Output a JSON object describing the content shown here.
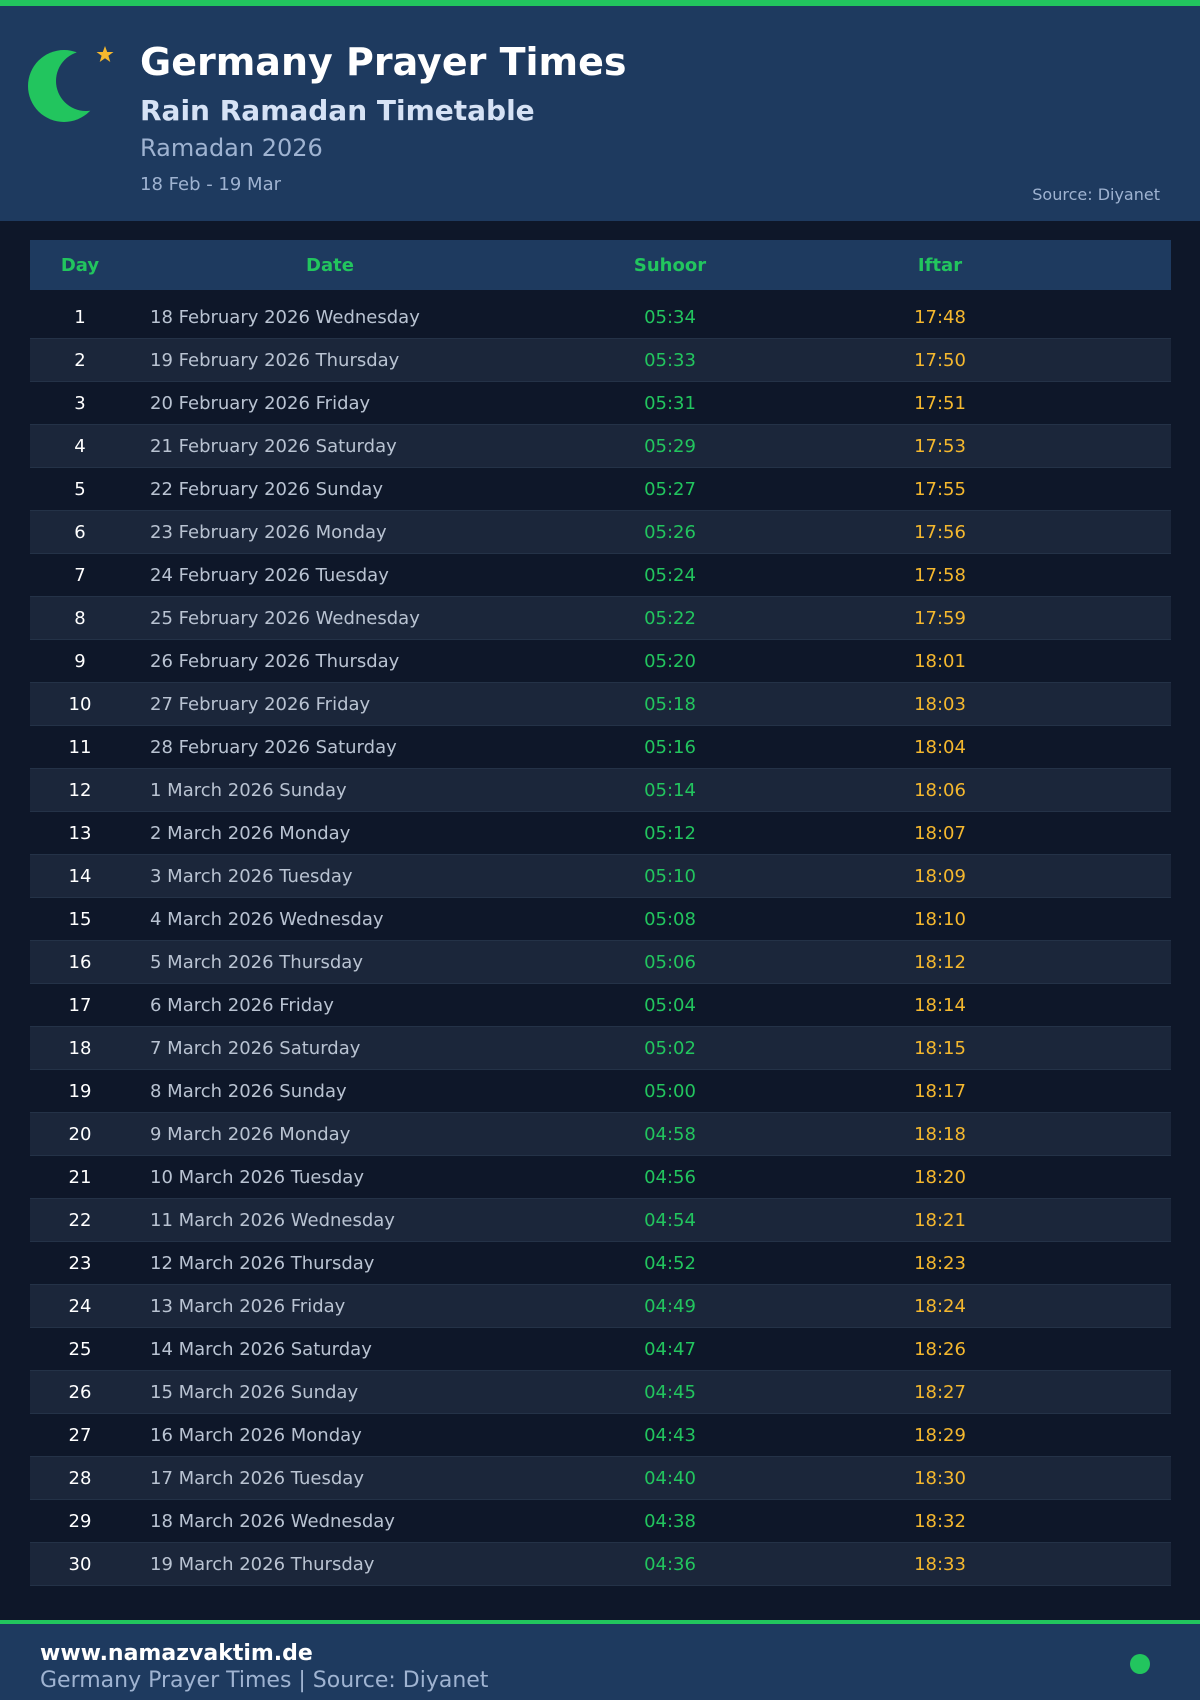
{
  "header": {
    "title": "Germany Prayer Times",
    "subtitle": "Rain Ramadan Timetable",
    "season": "Ramadan 2026",
    "range": "18 Feb - 19 Mar",
    "source": "Source: Diyanet",
    "logo_icon": "crescent-moon-star-icon"
  },
  "colors": {
    "accent_green": "#22c55e",
    "iftar_gold": "#f5b82e",
    "header_bg": "#1e3a5f",
    "page_bg": "#0e1729"
  },
  "table": {
    "columns": [
      "Day",
      "Date",
      "Suhoor",
      "Iftar"
    ],
    "rows": [
      {
        "day": "1",
        "date": "18 February 2026 Wednesday",
        "suhoor": "05:34",
        "iftar": "17:48"
      },
      {
        "day": "2",
        "date": "19 February 2026 Thursday",
        "suhoor": "05:33",
        "iftar": "17:50"
      },
      {
        "day": "3",
        "date": "20 February 2026 Friday",
        "suhoor": "05:31",
        "iftar": "17:51"
      },
      {
        "day": "4",
        "date": "21 February 2026 Saturday",
        "suhoor": "05:29",
        "iftar": "17:53"
      },
      {
        "day": "5",
        "date": "22 February 2026 Sunday",
        "suhoor": "05:27",
        "iftar": "17:55"
      },
      {
        "day": "6",
        "date": "23 February 2026 Monday",
        "suhoor": "05:26",
        "iftar": "17:56"
      },
      {
        "day": "7",
        "date": "24 February 2026 Tuesday",
        "suhoor": "05:24",
        "iftar": "17:58"
      },
      {
        "day": "8",
        "date": "25 February 2026 Wednesday",
        "suhoor": "05:22",
        "iftar": "17:59"
      },
      {
        "day": "9",
        "date": "26 February 2026 Thursday",
        "suhoor": "05:20",
        "iftar": "18:01"
      },
      {
        "day": "10",
        "date": "27 February 2026 Friday",
        "suhoor": "05:18",
        "iftar": "18:03"
      },
      {
        "day": "11",
        "date": "28 February 2026 Saturday",
        "suhoor": "05:16",
        "iftar": "18:04"
      },
      {
        "day": "12",
        "date": "1 March 2026 Sunday",
        "suhoor": "05:14",
        "iftar": "18:06"
      },
      {
        "day": "13",
        "date": "2 March 2026 Monday",
        "suhoor": "05:12",
        "iftar": "18:07"
      },
      {
        "day": "14",
        "date": "3 March 2026 Tuesday",
        "suhoor": "05:10",
        "iftar": "18:09"
      },
      {
        "day": "15",
        "date": "4 March 2026 Wednesday",
        "suhoor": "05:08",
        "iftar": "18:10"
      },
      {
        "day": "16",
        "date": "5 March 2026 Thursday",
        "suhoor": "05:06",
        "iftar": "18:12"
      },
      {
        "day": "17",
        "date": "6 March 2026 Friday",
        "suhoor": "05:04",
        "iftar": "18:14"
      },
      {
        "day": "18",
        "date": "7 March 2026 Saturday",
        "suhoor": "05:02",
        "iftar": "18:15"
      },
      {
        "day": "19",
        "date": "8 March 2026 Sunday",
        "suhoor": "05:00",
        "iftar": "18:17"
      },
      {
        "day": "20",
        "date": "9 March 2026 Monday",
        "suhoor": "04:58",
        "iftar": "18:18"
      },
      {
        "day": "21",
        "date": "10 March 2026 Tuesday",
        "suhoor": "04:56",
        "iftar": "18:20"
      },
      {
        "day": "22",
        "date": "11 March 2026 Wednesday",
        "suhoor": "04:54",
        "iftar": "18:21"
      },
      {
        "day": "23",
        "date": "12 March 2026 Thursday",
        "suhoor": "04:52",
        "iftar": "18:23"
      },
      {
        "day": "24",
        "date": "13 March 2026 Friday",
        "suhoor": "04:49",
        "iftar": "18:24"
      },
      {
        "day": "25",
        "date": "14 March 2026 Saturday",
        "suhoor": "04:47",
        "iftar": "18:26"
      },
      {
        "day": "26",
        "date": "15 March 2026 Sunday",
        "suhoor": "04:45",
        "iftar": "18:27"
      },
      {
        "day": "27",
        "date": "16 March 2026 Monday",
        "suhoor": "04:43",
        "iftar": "18:29"
      },
      {
        "day": "28",
        "date": "17 March 2026 Tuesday",
        "suhoor": "04:40",
        "iftar": "18:30"
      },
      {
        "day": "29",
        "date": "18 March 2026 Wednesday",
        "suhoor": "04:38",
        "iftar": "18:32"
      },
      {
        "day": "30",
        "date": "19 March 2026 Thursday",
        "suhoor": "04:36",
        "iftar": "18:33"
      }
    ]
  },
  "footer": {
    "url": "www.namazvaktim.de",
    "text": "Germany Prayer Times | Source: Diyanet",
    "status_icon": "status-dot-icon"
  }
}
